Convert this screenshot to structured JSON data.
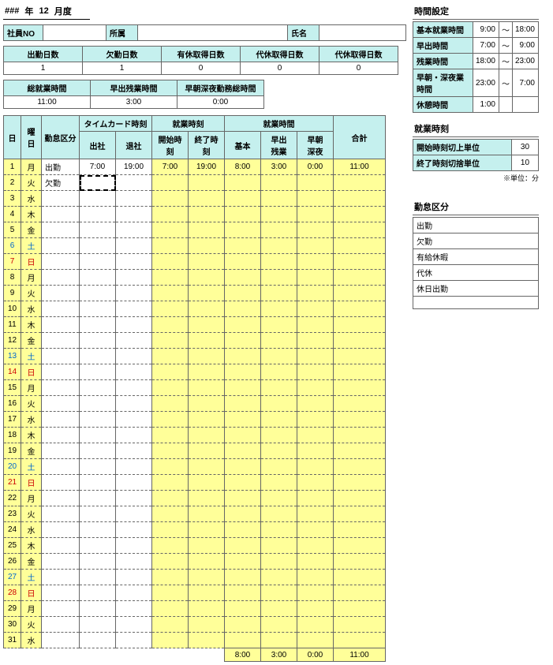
{
  "title": {
    "prefix": "###",
    "year_label": "年",
    "month": "12",
    "month_label": "月度"
  },
  "info": {
    "emp_no_label": "社員NO",
    "emp_no": "",
    "dept_label": "所属",
    "dept": "",
    "name_label": "氏名",
    "name": ""
  },
  "summary1": {
    "headers": [
      "出勤日数",
      "欠勤日数",
      "有休取得日数",
      "代休取得日数",
      "代休取得日数"
    ],
    "values": [
      "1",
      "1",
      "0",
      "0",
      "0"
    ]
  },
  "summary2": {
    "headers": [
      "総就業時間",
      "早出残業時間",
      "早朝深夜勤務総時間"
    ],
    "values": [
      "11:00",
      "3:00",
      "0:00"
    ]
  },
  "main_headers": {
    "day": "日",
    "dow": "曜日",
    "kubun": "勤怠区分",
    "timecard": "タイムカード時刻",
    "in": "出社",
    "out": "退社",
    "worktime": "就業時刻",
    "start": "開始時刻",
    "end": "終了時刻",
    "workhrs": "就業時間",
    "basic": "基本",
    "hayade": "早出\n残業",
    "soucho": "早朝\n深夜",
    "total": "合計"
  },
  "days": [
    {
      "d": "1",
      "w": "月",
      "wc": "",
      "k": "出勤",
      "tc_in": "7:00",
      "tc_out": "19:00",
      "st": "7:00",
      "et": "19:00",
      "b": "8:00",
      "h": "3:00",
      "s": "0:00",
      "t": "11:00"
    },
    {
      "d": "2",
      "w": "火",
      "wc": "",
      "k": "欠勤",
      "sel": true
    },
    {
      "d": "3",
      "w": "水",
      "wc": ""
    },
    {
      "d": "4",
      "w": "木",
      "wc": ""
    },
    {
      "d": "5",
      "w": "金",
      "wc": ""
    },
    {
      "d": "6",
      "w": "土",
      "wc": "sat"
    },
    {
      "d": "7",
      "w": "日",
      "wc": "sun"
    },
    {
      "d": "8",
      "w": "月",
      "wc": ""
    },
    {
      "d": "9",
      "w": "火",
      "wc": ""
    },
    {
      "d": "10",
      "w": "水",
      "wc": ""
    },
    {
      "d": "11",
      "w": "木",
      "wc": ""
    },
    {
      "d": "12",
      "w": "金",
      "wc": ""
    },
    {
      "d": "13",
      "w": "土",
      "wc": "sat"
    },
    {
      "d": "14",
      "w": "日",
      "wc": "sun"
    },
    {
      "d": "15",
      "w": "月",
      "wc": ""
    },
    {
      "d": "16",
      "w": "火",
      "wc": ""
    },
    {
      "d": "17",
      "w": "水",
      "wc": ""
    },
    {
      "d": "18",
      "w": "木",
      "wc": ""
    },
    {
      "d": "19",
      "w": "金",
      "wc": ""
    },
    {
      "d": "20",
      "w": "土",
      "wc": "sat"
    },
    {
      "d": "21",
      "w": "日",
      "wc": "sun"
    },
    {
      "d": "22",
      "w": "月",
      "wc": ""
    },
    {
      "d": "23",
      "w": "火",
      "wc": ""
    },
    {
      "d": "24",
      "w": "水",
      "wc": ""
    },
    {
      "d": "25",
      "w": "木",
      "wc": ""
    },
    {
      "d": "26",
      "w": "金",
      "wc": ""
    },
    {
      "d": "27",
      "w": "土",
      "wc": "sat"
    },
    {
      "d": "28",
      "w": "日",
      "wc": "sun"
    },
    {
      "d": "29",
      "w": "月",
      "wc": ""
    },
    {
      "d": "30",
      "w": "火",
      "wc": ""
    },
    {
      "d": "31",
      "w": "水",
      "wc": ""
    }
  ],
  "totals": {
    "b": "8:00",
    "h": "3:00",
    "s": "0:00",
    "t": "11:00"
  },
  "time_settings": {
    "title": "時間設定",
    "rows": [
      {
        "label": "基本就業時間",
        "from": "9:00",
        "sep": "～",
        "to": "18:00"
      },
      {
        "label": "早出時間",
        "from": "7:00",
        "sep": "～",
        "to": "9:00"
      },
      {
        "label": "残業時間",
        "from": "18:00",
        "sep": "～",
        "to": "23:00"
      },
      {
        "label": "早朝・深夜業時間",
        "from": "23:00",
        "sep": "～",
        "to": "7:00"
      },
      {
        "label": "休憩時間",
        "from": "1:00",
        "sep": "",
        "to": ""
      }
    ]
  },
  "work_time_units": {
    "title": "就業時刻",
    "rows": [
      {
        "label": "開始時刻切上単位",
        "val": "30"
      },
      {
        "label": "終了時刻切捨単位",
        "val": "10"
      }
    ],
    "note": "※単位：分"
  },
  "kubun_list": {
    "title": "勤怠区分",
    "items": [
      "出勤",
      "欠勤",
      "有給休暇",
      "代休",
      "休日出勤",
      ""
    ]
  }
}
